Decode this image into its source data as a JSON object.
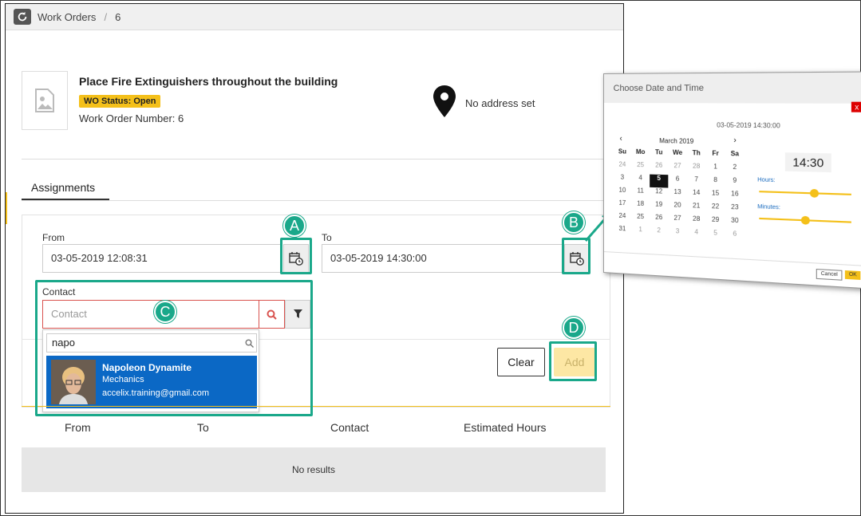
{
  "colors": {
    "accent": "#f4c01a",
    "highlight": "#1aa88a",
    "selection": "#0b68c5",
    "error": "#d9534f"
  },
  "breadcrumb": {
    "section": "Work Orders",
    "separator": "/",
    "id": "6"
  },
  "work_order": {
    "title": "Place Fire Extinguishers throughout the building",
    "status": "WO Status: Open",
    "number_label": "Work Order Number:",
    "number_value": "6",
    "address": "No address set"
  },
  "tabs": [
    {
      "label": "Assignments"
    }
  ],
  "form": {
    "from_label": "From",
    "from_value": "03-05-2019 12:08:31",
    "to_label": "To",
    "to_value": "03-05-2019 14:30:00",
    "contact_label": "Contact",
    "contact_placeholder": "Contact",
    "search_query": "napo",
    "result": {
      "name": "Napoleon Dynamite",
      "role": "Mechanics",
      "email": "accelix.training@gmail.com"
    },
    "clear_label": "Clear",
    "add_label": "Add"
  },
  "table": {
    "columns": [
      "From",
      "To",
      "Contact",
      "Estimated Hours"
    ],
    "empty_text": "No results"
  },
  "markers": {
    "a": "A",
    "b": "B",
    "c": "C",
    "d": "D"
  },
  "datetime_popup": {
    "title": "Choose Date and Time",
    "close": "x",
    "current": "03-05-2019 14:30:00",
    "prev": "‹",
    "next": "›",
    "month": "March 2019",
    "weekdays": [
      "Su",
      "Mo",
      "Tu",
      "We",
      "Th",
      "Fr",
      "Sa"
    ],
    "weeks": [
      [
        "24",
        "25",
        "26",
        "27",
        "28",
        "1",
        "2"
      ],
      [
        "3",
        "4",
        "5",
        "6",
        "7",
        "8",
        "9"
      ],
      [
        "10",
        "11",
        "12",
        "13",
        "14",
        "15",
        "16"
      ],
      [
        "17",
        "18",
        "19",
        "20",
        "21",
        "22",
        "23"
      ],
      [
        "24",
        "25",
        "26",
        "27",
        "28",
        "29",
        "30"
      ],
      [
        "31",
        "1",
        "2",
        "3",
        "4",
        "5",
        "6"
      ]
    ],
    "selected_day": "5",
    "time": "14:30",
    "hours_label": "Hours:",
    "minutes_label": "Minutes:",
    "hours_value": 14,
    "minutes_value": 30,
    "cancel_label": "Cancel",
    "ok_label": "OK"
  }
}
